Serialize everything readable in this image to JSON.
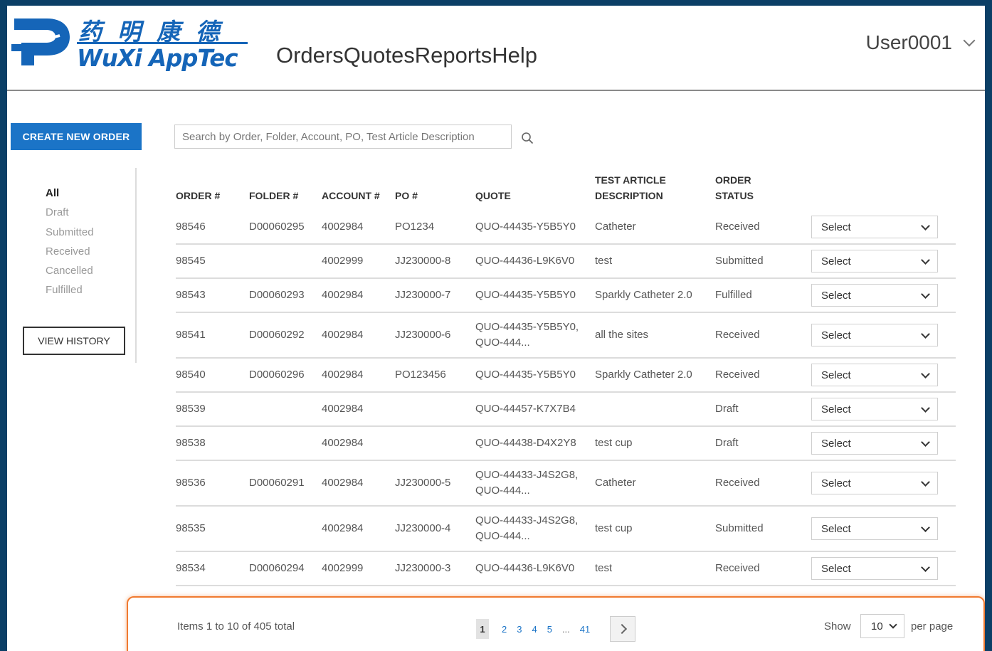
{
  "brand": {
    "chinese": "药明康德",
    "english": "WuXi AppTec",
    "color": "#1565b8"
  },
  "nav": [
    "Orders",
    "Quotes",
    "Reports",
    "Help"
  ],
  "user": {
    "name": "User0001"
  },
  "actions": {
    "create_order": "CREATE NEW ORDER",
    "view_history": "VIEW HISTORY"
  },
  "filters": [
    {
      "label": "All",
      "active": true
    },
    {
      "label": "Draft",
      "active": false
    },
    {
      "label": "Submitted",
      "active": false
    },
    {
      "label": "Received",
      "active": false
    },
    {
      "label": "Cancelled",
      "active": false
    },
    {
      "label": "Fulfilled",
      "active": false
    }
  ],
  "search": {
    "placeholder": "Search by Order, Folder, Account, PO, Test Article Description",
    "value": ""
  },
  "table": {
    "headers": {
      "order": "ORDER #",
      "folder": "FOLDER #",
      "account": "ACCOUNT #",
      "po": "PO #",
      "quote": "QUOTE",
      "test_article_1": "TEST ARTICLE",
      "test_article_2": "DESCRIPTION",
      "status_1": "ORDER",
      "status_2": "STATUS"
    },
    "select_label": "Select",
    "rows": [
      {
        "order": "98546",
        "folder": "D00060295",
        "account": "4002984",
        "po": "PO1234",
        "quote": [
          "QUO-44435-Y5B5Y0"
        ],
        "description": "Catheter",
        "status": "Received"
      },
      {
        "order": "98545",
        "folder": "",
        "account": "4002999",
        "po": "JJ230000-8",
        "quote": [
          "QUO-44436-L9K6V0"
        ],
        "description": "test",
        "status": "Submitted"
      },
      {
        "order": "98543",
        "folder": "D00060293",
        "account": "4002984",
        "po": "JJ230000-7",
        "quote": [
          "QUO-44435-Y5B5Y0"
        ],
        "description": "Sparkly Catheter 2.0",
        "status": "Fulfilled"
      },
      {
        "order": "98541",
        "folder": "D00060292",
        "account": "4002984",
        "po": "JJ230000-6",
        "quote": [
          "QUO-44435-Y5B5Y0,",
          "QUO-444..."
        ],
        "description": "all the sites",
        "status": "Received"
      },
      {
        "order": "98540",
        "folder": "D00060296",
        "account": "4002984",
        "po": "PO123456",
        "quote": [
          "QUO-44435-Y5B5Y0"
        ],
        "description": "Sparkly Catheter 2.0",
        "status": "Received"
      },
      {
        "order": "98539",
        "folder": "",
        "account": "4002984",
        "po": "",
        "quote": [
          "QUO-44457-K7X7B4"
        ],
        "description": "",
        "status": "Draft"
      },
      {
        "order": "98538",
        "folder": "",
        "account": "4002984",
        "po": "",
        "quote": [
          "QUO-44438-D4X2Y8"
        ],
        "description": "test cup",
        "status": "Draft"
      },
      {
        "order": "98536",
        "folder": "D00060291",
        "account": "4002984",
        "po": "JJ230000-5",
        "quote": [
          "QUO-44433-J4S2G8,",
          "QUO-444..."
        ],
        "description": "Catheter",
        "status": "Received"
      },
      {
        "order": "98535",
        "folder": "",
        "account": "4002984",
        "po": "JJ230000-4",
        "quote": [
          "QUO-44433-J4S2G8,",
          "QUO-444..."
        ],
        "description": "test cup",
        "status": "Submitted"
      },
      {
        "order": "98534",
        "folder": "D00060294",
        "account": "4002999",
        "po": "JJ230000-3",
        "quote": [
          "QUO-44436-L9K6V0"
        ],
        "description": "test",
        "status": "Received"
      }
    ]
  },
  "pagination": {
    "summary": "Items 1 to 10 of 405 total",
    "pages": [
      "1",
      "2",
      "3",
      "4",
      "5",
      "...",
      "41"
    ],
    "current": "1",
    "show_label": "Show",
    "per_page_value": "10",
    "per_page_label": "per page"
  },
  "colors": {
    "accent": "#1b74c7",
    "frame": "#0b3f66",
    "highlight": "#f07a30"
  }
}
